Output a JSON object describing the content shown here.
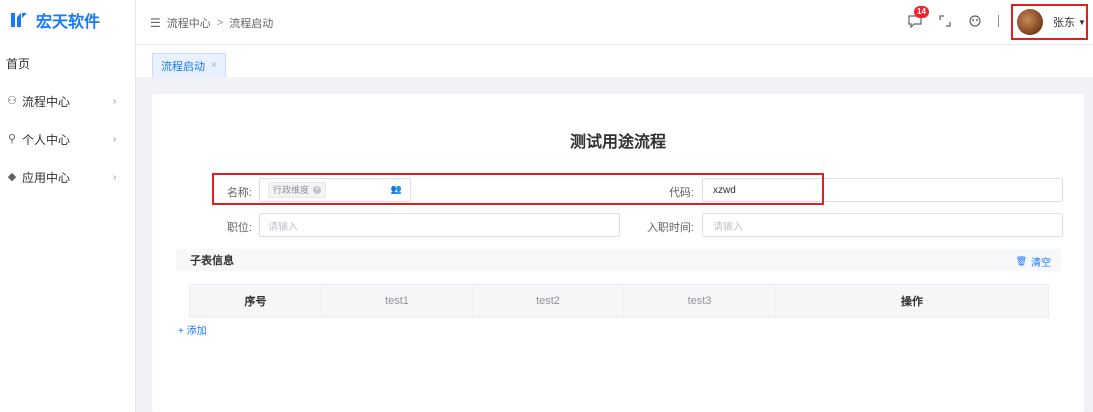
{
  "brand": {
    "name": "宏天软件",
    "color": "#1677ff"
  },
  "sidebar": {
    "items": [
      {
        "label": "首页",
        "icon": ""
      },
      {
        "label": "流程中心",
        "icon": "flow-icon"
      },
      {
        "label": "个人中心",
        "icon": "user-icon"
      },
      {
        "label": "应用中心",
        "icon": "apps-icon"
      }
    ]
  },
  "header": {
    "breadcrumb": [
      "流程中心",
      "流程启动"
    ],
    "breadcrumb_sep": ">",
    "notification_count": "14",
    "user_name": "张东"
  },
  "tabs": [
    {
      "label": "流程启动",
      "close": "×"
    }
  ],
  "form": {
    "title": "测试用途流程",
    "fields": {
      "name": {
        "label": "名称:",
        "tag": "行政维度",
        "tag_close": "×"
      },
      "code": {
        "label": "代码:",
        "value": "xzwd"
      },
      "position": {
        "label": "职位:",
        "placeholder": "请输入"
      },
      "hire_date": {
        "label": "入职时间:",
        "placeholder": "请输入"
      }
    }
  },
  "subtable": {
    "title": "子表信息",
    "clear_label": "清空",
    "columns": [
      "序号",
      "test1",
      "test2",
      "test3",
      "操作"
    ],
    "add_label": "+ 添加"
  }
}
